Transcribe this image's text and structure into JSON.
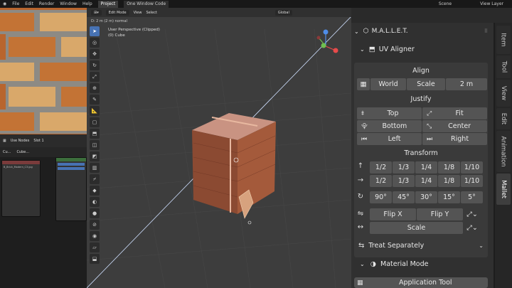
{
  "menu": {
    "items": [
      "File",
      "Edit",
      "Render",
      "Window",
      "Help"
    ],
    "workspace_tabs": [
      "Project",
      "One Window Code"
    ],
    "scene": "Scene",
    "view_layer": "View Layer"
  },
  "node_editor": {
    "use_nodes": "Use Nodes",
    "slot": "Slot 1",
    "object": "Cu...",
    "material": "Cube...",
    "image": "B_Brick_Modern_C3.jpg"
  },
  "viewport": {
    "mode": "Edit Mode",
    "view_menu": "View",
    "select_menu": "Select",
    "transform_orientation": "Global",
    "status": "D: 2 m (2 m) normal",
    "perspective": "User Perspective (Clipped)",
    "object_name": "(0) Cube"
  },
  "panel": {
    "addon_title": "M.A.L.L.E.T.",
    "uv_aligner": "UV Aligner",
    "align": {
      "title": "Align",
      "buttons": [
        "World",
        "Scale",
        "2 m"
      ]
    },
    "justify": {
      "title": "Justify",
      "buttons": [
        "Top",
        "Fit",
        "Bottom",
        "Center",
        "Left",
        "Right"
      ]
    },
    "transform": {
      "title": "Transform",
      "up_row": [
        "1/2",
        "1/3",
        "1/4",
        "1/8",
        "1/10"
      ],
      "right_row": [
        "1/2",
        "1/3",
        "1/4",
        "1/8",
        "1/10"
      ],
      "rotate_row": [
        "90°",
        "45°",
        "30°",
        "15°",
        "5°"
      ],
      "flip_x": "Flip X",
      "flip_y": "Flip Y",
      "scale": "Scale"
    },
    "treat_separately": "Treat Separately",
    "material_mode": "Material Mode",
    "application_tool": "Application Tool"
  },
  "sidebar_tabs": [
    "Item",
    "Tool",
    "View",
    "Edit",
    "Animation",
    "Mallet"
  ],
  "active_sidebar_tab": "Mallet",
  "colors": {
    "accent": "#4772b3",
    "button": "#545454",
    "panel": "#303030",
    "viewport": "#3d3d3d"
  }
}
